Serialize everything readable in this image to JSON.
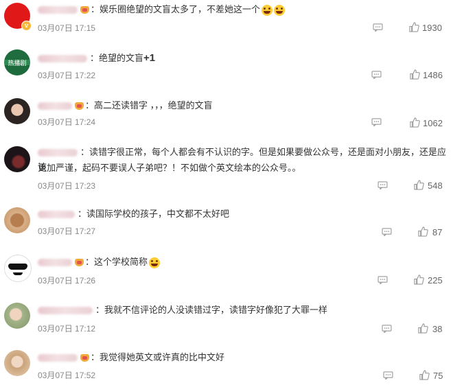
{
  "comments": [
    {
      "text": "：娱乐圈绝望的文盲太多了，不差她这一个",
      "time": "03月07日 17:15",
      "likes": "1930"
    },
    {
      "text": "：绝望的文盲",
      "text_suffix": "+1",
      "avatar_text": "热播剧",
      "time": "03月07日 17:22",
      "likes": "1486"
    },
    {
      "text": "：高二还读错字 ，，，绝望的文盲",
      "time": "03月07日 17:24",
      "likes": "1062"
    },
    {
      "text": "：读错字很正常，每个人都会有不认识的字。但是如果要做公众号，还是面对小朋友，还是应该",
      "text_line2": "更加严谨，起码不要误人子弟吧？！不如做个英文绘本的公众号。。",
      "time": "03月07日 17:23",
      "likes": "548"
    },
    {
      "text": "：读国际学校的孩子，中文都不太好吧",
      "time": "03月07日 17:27",
      "likes": "87"
    },
    {
      "text": "：这个学校简称",
      "time": "03月07日 17:26",
      "likes": "225"
    },
    {
      "text": "：我就不信评论的人没读错过字，读错字好像犯了大罪一样",
      "time": "03月07日 17:12",
      "likes": "38"
    },
    {
      "text": "：我觉得她英文或许真的比中文好",
      "time": "03月07日 17:52",
      "likes": "75"
    }
  ]
}
